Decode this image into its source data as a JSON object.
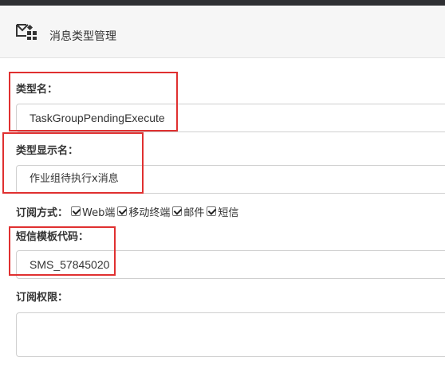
{
  "header": {
    "title": "消息类型管理",
    "icon": "message-type-icon"
  },
  "form": {
    "type_name": {
      "label": "类型名：",
      "value": "TaskGroupPendingExecute"
    },
    "display_name": {
      "label": "类型显示名：",
      "value": "作业组待执行x消息"
    },
    "subscription": {
      "label": "订阅方式：",
      "options": [
        {
          "label": "Web端",
          "checked": true
        },
        {
          "label": "移动终端",
          "checked": true
        },
        {
          "label": "邮件",
          "checked": true
        },
        {
          "label": "短信",
          "checked": true
        }
      ]
    },
    "sms_template": {
      "label": "短信模板代码：",
      "value": "SMS_57845020"
    },
    "permission": {
      "label": "订阅权限：",
      "value": ""
    }
  },
  "colors": {
    "annotation": "#e03030",
    "topbar": "#2f3033",
    "header_bg": "#f6f6f6"
  }
}
